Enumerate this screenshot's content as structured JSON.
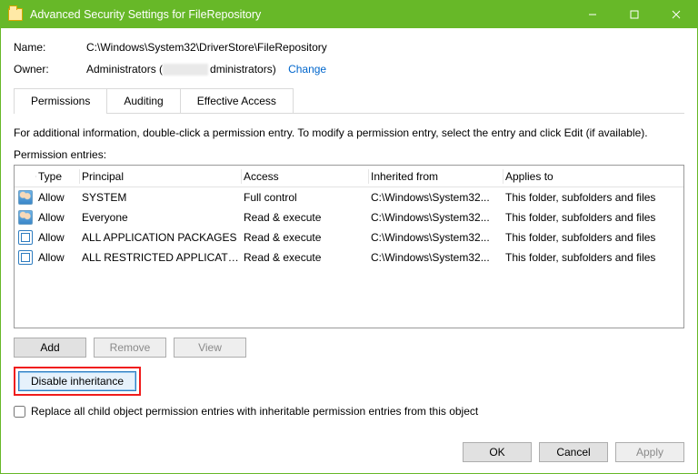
{
  "window": {
    "title": "Advanced Security Settings for FileRepository"
  },
  "fields": {
    "name_label": "Name:",
    "name_value": "C:\\Windows\\System32\\DriverStore\\FileRepository",
    "owner_label": "Owner:",
    "owner_prefix": "Administrators (",
    "owner_suffix": "dministrators)",
    "change": "Change"
  },
  "tabs": {
    "permissions": "Permissions",
    "auditing": "Auditing",
    "effective": "Effective Access"
  },
  "info_text": "For additional information, double-click a permission entry. To modify a permission entry, select the entry and click Edit (if available).",
  "entries_label": "Permission entries:",
  "columns": {
    "type": "Type",
    "principal": "Principal",
    "access": "Access",
    "inherited": "Inherited from",
    "applies": "Applies to"
  },
  "rows": [
    {
      "icon": "users",
      "type": "Allow",
      "principal": "SYSTEM",
      "access": "Full control",
      "inherited": "C:\\Windows\\System32...",
      "applies": "This folder, subfolders and files"
    },
    {
      "icon": "users",
      "type": "Allow",
      "principal": "Everyone",
      "access": "Read & execute",
      "inherited": "C:\\Windows\\System32...",
      "applies": "This folder, subfolders and files"
    },
    {
      "icon": "pkg",
      "type": "Allow",
      "principal": "ALL APPLICATION PACKAGES",
      "access": "Read & execute",
      "inherited": "C:\\Windows\\System32...",
      "applies": "This folder, subfolders and files"
    },
    {
      "icon": "pkg",
      "type": "Allow",
      "principal": "ALL RESTRICTED APPLICATIO...",
      "access": "Read & execute",
      "inherited": "C:\\Windows\\System32...",
      "applies": "This folder, subfolders and files"
    }
  ],
  "buttons": {
    "add": "Add",
    "remove": "Remove",
    "view": "View",
    "disable_inh": "Disable inheritance",
    "ok": "OK",
    "cancel": "Cancel",
    "apply": "Apply"
  },
  "checkbox": {
    "replace_label": "Replace all child object permission entries with inheritable permission entries from this object"
  }
}
